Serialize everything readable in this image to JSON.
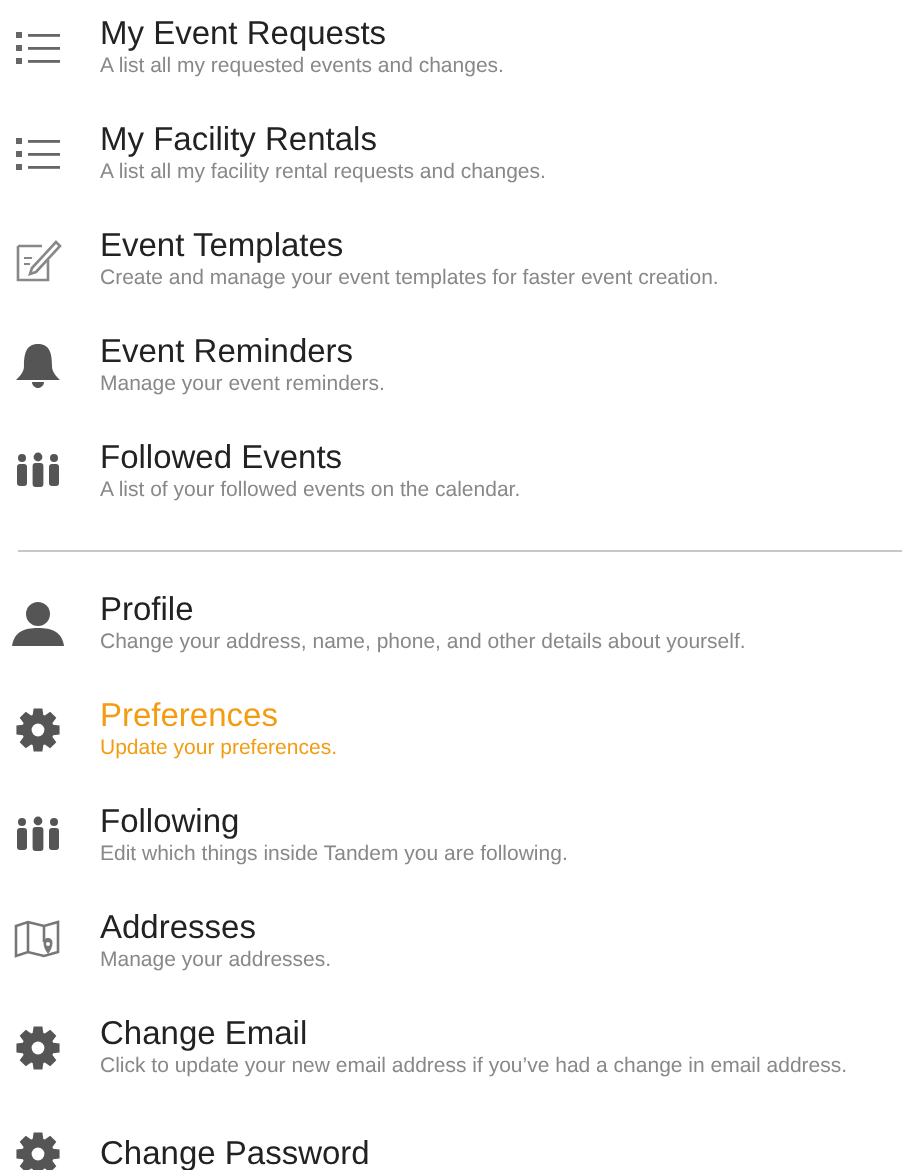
{
  "sections": [
    {
      "items": [
        {
          "kind": "list",
          "title": "My Event Requests",
          "description": "A list all my requested events and changes.",
          "selected": false
        },
        {
          "kind": "list",
          "title": "My Facility Rentals",
          "description": "A list all my facility rental requests and changes.",
          "selected": false
        },
        {
          "kind": "edit",
          "title": "Event Templates",
          "description": "Create and manage your event templates for faster event creation.",
          "selected": false
        },
        {
          "kind": "bell",
          "title": "Event Reminders",
          "description": "Manage your event reminders.",
          "selected": false
        },
        {
          "kind": "people",
          "title": "Followed Events",
          "description": "A list of your followed events on the calendar.",
          "selected": false
        }
      ]
    },
    {
      "items": [
        {
          "kind": "person",
          "title": "Profile",
          "description": "Change your address, name, phone, and other details about yourself.",
          "selected": false
        },
        {
          "kind": "gear",
          "title": "Preferences",
          "description": "Update your preferences.",
          "selected": true
        },
        {
          "kind": "people",
          "title": "Following",
          "description": "Edit which things inside Tandem you are following.",
          "selected": false
        },
        {
          "kind": "map",
          "title": "Addresses",
          "description": "Manage your addresses.",
          "selected": false
        },
        {
          "kind": "gear",
          "title": "Change Email",
          "description": "Click to update your new email address if you’ve had a change in email address.",
          "selected": false
        },
        {
          "kind": "gear",
          "title": "Change Password",
          "selected": false
        }
      ]
    }
  ]
}
